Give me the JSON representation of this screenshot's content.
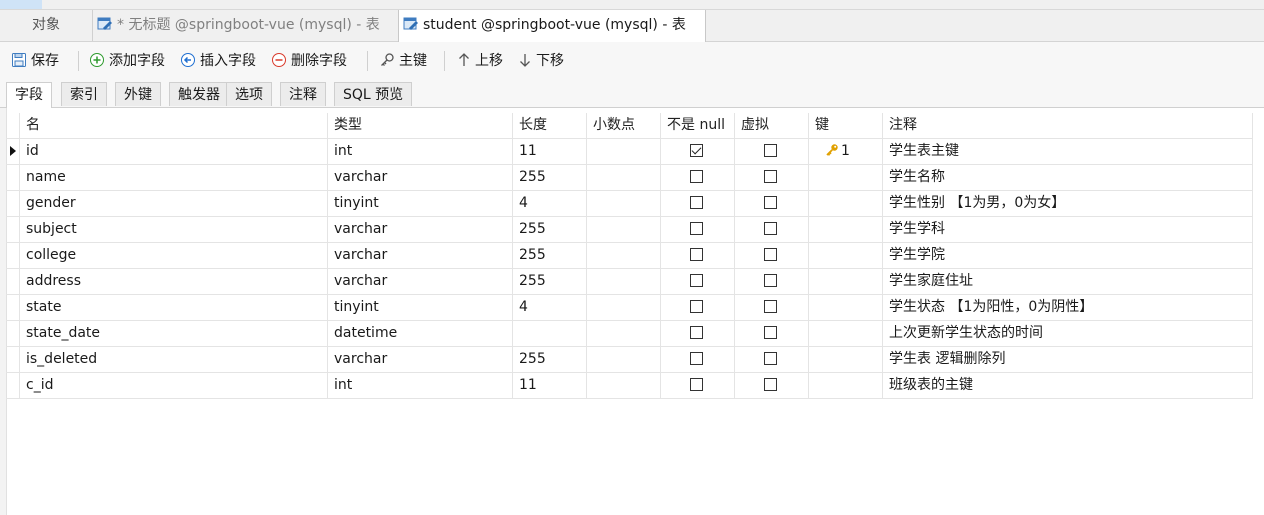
{
  "tabs": {
    "objects": "对象",
    "untitled": "* 无标题 @springboot-vue (mysql) - 表",
    "student": "student @springboot-vue (mysql) - 表"
  },
  "toolbar": {
    "save": "保存",
    "add_field": "添加字段",
    "insert_field": "插入字段",
    "delete_field": "删除字段",
    "primary_key": "主键",
    "move_up": "上移",
    "move_down": "下移"
  },
  "subtabs": [
    "字段",
    "索引",
    "外键",
    "触发器",
    "选项",
    "注释",
    "SQL 预览"
  ],
  "columns": [
    "名",
    "类型",
    "长度",
    "小数点",
    "不是 null",
    "虚拟",
    "键",
    "注释"
  ],
  "rows": [
    {
      "name": "id",
      "type": "int",
      "length": "11",
      "decimals": "",
      "not_null": true,
      "virtual": false,
      "key": "1",
      "comment": "学生表主键"
    },
    {
      "name": "name",
      "type": "varchar",
      "length": "255",
      "decimals": "",
      "not_null": false,
      "virtual": false,
      "key": "",
      "comment": "学生名称"
    },
    {
      "name": "gender",
      "type": "tinyint",
      "length": "4",
      "decimals": "",
      "not_null": false,
      "virtual": false,
      "key": "",
      "comment": "学生性别 【1为男，0为女】"
    },
    {
      "name": "subject",
      "type": "varchar",
      "length": "255",
      "decimals": "",
      "not_null": false,
      "virtual": false,
      "key": "",
      "comment": "学生学科"
    },
    {
      "name": "college",
      "type": "varchar",
      "length": "255",
      "decimals": "",
      "not_null": false,
      "virtual": false,
      "key": "",
      "comment": "学生学院"
    },
    {
      "name": "address",
      "type": "varchar",
      "length": "255",
      "decimals": "",
      "not_null": false,
      "virtual": false,
      "key": "",
      "comment": "学生家庭住址"
    },
    {
      "name": "state",
      "type": "tinyint",
      "length": "4",
      "decimals": "",
      "not_null": false,
      "virtual": false,
      "key": "",
      "comment": "学生状态 【1为阳性，0为阴性】"
    },
    {
      "name": "state_date",
      "type": "datetime",
      "length": "",
      "decimals": "",
      "not_null": false,
      "virtual": false,
      "key": "",
      "comment": "上次更新学生状态的时间"
    },
    {
      "name": "is_deleted",
      "type": "varchar",
      "length": "255",
      "decimals": "",
      "not_null": false,
      "virtual": false,
      "key": "",
      "comment": "学生表 逻辑删除列"
    },
    {
      "name": "c_id",
      "type": "int",
      "length": "11",
      "decimals": "",
      "not_null": false,
      "virtual": false,
      "key": "",
      "comment": "班级表的主键"
    }
  ],
  "colors": {
    "key_icon": "#e0a000",
    "add_icon": "#2e9a2e",
    "insert_icon": "#1f6fd1",
    "delete_icon": "#d93a2b"
  }
}
